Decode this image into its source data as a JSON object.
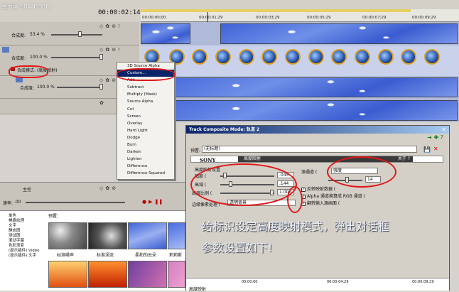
{
  "watermark": "主页网 SIIAN.COM",
  "timecode": "00:00:02:14",
  "ruler_ticks": [
    "00:00:00;00",
    "00:00:01;29",
    "00:00:03;29",
    "00:00:05;29",
    "00:00:07;29",
    "00:00:09;29"
  ],
  "track1": {
    "label": "合成度:",
    "value": "53.4 %"
  },
  "track2": {
    "label": "合成度:",
    "value": "100.0 %",
    "composite_label": "合成模式: (高度映射)"
  },
  "track3": {
    "label": "合成度:",
    "value": "100.0 %"
  },
  "context_menu": {
    "items": [
      "3D Source Alpha",
      "Custom...",
      "Add",
      "Subtract",
      "Multiply (Mask)",
      "Source Alpha",
      "Cut",
      "Screen",
      "Overlay",
      "Hard Light",
      "Dodge",
      "Burn",
      "Darken",
      "Lighten",
      "Difference",
      "Difference Squared"
    ],
    "selected": "Custom..."
  },
  "master": {
    "title": "主控",
    "speed_label": "速率:",
    "speed_value": ".00"
  },
  "preset_panel": {
    "categories": [
      "单色",
      "棋盘纹理",
      "文字",
      "静态图",
      "测试图",
      "滚动字幕",
      "色彩渐变",
      "(提示插件) Video",
      "(提示插件) 文字"
    ],
    "header": "预置:",
    "thumbs": [
      "标准噪声",
      "标准涡流",
      "柔和的云朵",
      "莉莉斯"
    ]
  },
  "dialog": {
    "title": "Track Composite Mode: 轨道 2",
    "preset_label": "预置:",
    "preset_value": "(无标题)",
    "brand": "SONY",
    "plugin_name": "高度映射",
    "about": "关于 ?",
    "height_group": "高度映射设置",
    "width_label": "幅度 (",
    "width_value": ".045",
    "height_label": "高域 (",
    "height_value": ".144",
    "ratio_label": "高度比例 (",
    "ratio_value": "1.000",
    "edge_label": "边缘像素处理 (",
    "edge_value": "透明背景",
    "source_label": "源通道 (",
    "source_value": "强度",
    "source_amount": "14",
    "cb1": "反转映射数据 (",
    "cb2": "Alpha 通道换算成 RGB 通道 (",
    "cb3": "翻转输入源画面 (",
    "bottom_left": "高度映射",
    "time_ticks": [
      "00:00:00",
      "00:00:04:29",
      "00:00:09:29"
    ]
  },
  "annotation": {
    "line1": "给标识设定高度映射模式，弹出对话框",
    "line2": "参数设置如下!"
  }
}
